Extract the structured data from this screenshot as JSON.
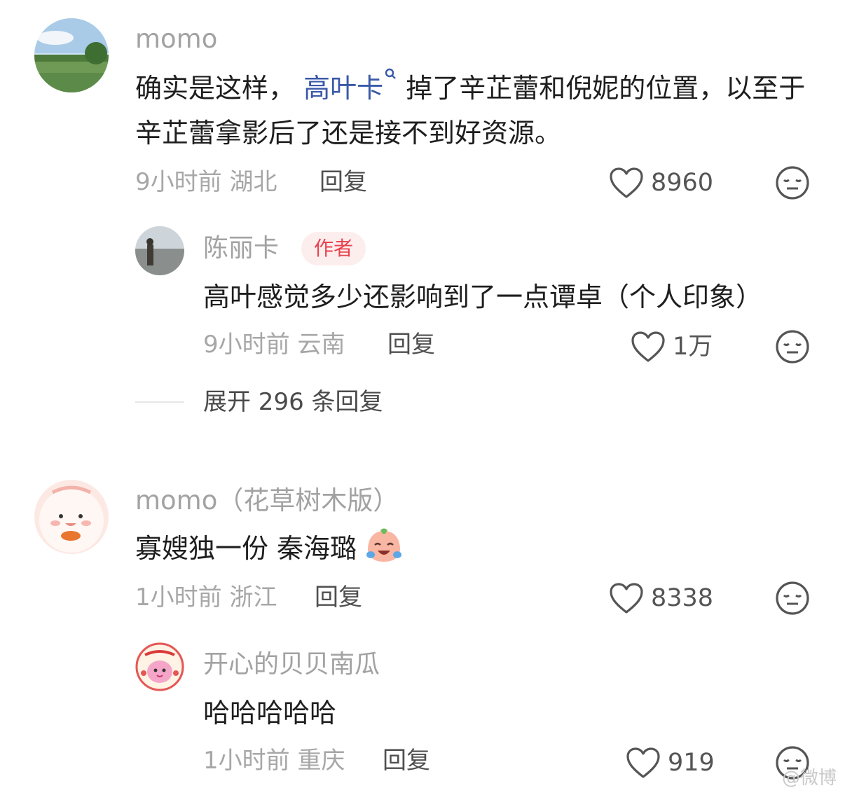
{
  "comments": [
    {
      "user": "momo",
      "text_before": "确实是这样，",
      "topic": "高叶卡",
      "text_after": "掉了辛芷蕾和倪妮的位置，以至于辛芷蕾拿影后了还是接不到好资源。",
      "time": "9小时前",
      "location": "湖北",
      "reply_label": "回复",
      "likes": "8960",
      "replies": [
        {
          "user": "陈丽卡",
          "badge": "作者",
          "text": "高叶感觉多少还影响到了一点谭卓（个人印象）",
          "time": "9小时前",
          "location": "云南",
          "reply_label": "回复",
          "likes": "1万"
        }
      ],
      "expand_label": "展开 296 条回复"
    },
    {
      "user": "momo（花草树木版）",
      "text": "寡嫂独一份 秦海璐",
      "time": "1小时前",
      "location": "浙江",
      "reply_label": "回复",
      "likes": "8338",
      "replies": [
        {
          "user": "开心的贝贝南瓜",
          "text": "哈哈哈哈哈",
          "time": "1小时前",
          "location": "重庆",
          "reply_label": "回复",
          "likes": "919"
        }
      ]
    }
  ],
  "watermark": "@微博",
  "colors": {
    "topic": "#3a59a8",
    "badge_text": "#e8434e",
    "badge_bg": "#fdeeee",
    "secondary": "#a7a7a7"
  }
}
